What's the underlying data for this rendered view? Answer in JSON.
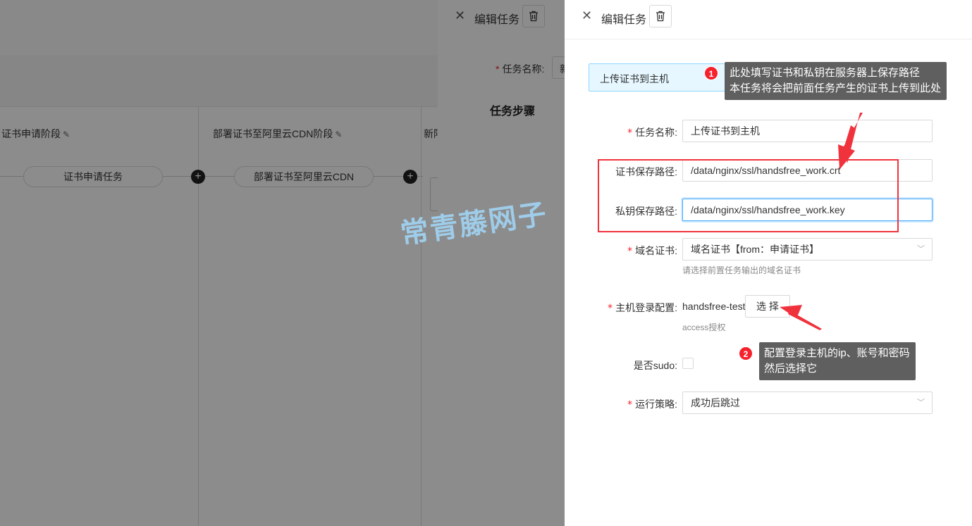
{
  "background": {
    "stages": [
      {
        "title": "证书申请阶段",
        "task": "证书申请任务"
      },
      {
        "title": "部署证书至阿里云CDN阶段",
        "task": "部署证书至阿里云CDN"
      },
      {
        "title": "新阿"
      }
    ],
    "edit_icon": "pencil-icon",
    "add_icon": "plus-icon"
  },
  "drawer_back": {
    "title": "编辑任务",
    "task_name_label": "任务名称:",
    "task_name_value_partial": "新",
    "steps_heading": "任务步骤"
  },
  "drawer": {
    "title": "编辑任务",
    "close_icon": "close-icon",
    "delete_icon": "trash-icon",
    "task_type": "上传证书到主机",
    "fields": {
      "task_name": {
        "label": "任务名称:",
        "value": "上传证书到主机"
      },
      "cert_path": {
        "label": "证书保存路径:",
        "value": "/data/nginx/ssl/handsfree_work.crt"
      },
      "key_path": {
        "label": "私钥保存路径:",
        "value": "/data/nginx/ssl/handsfree_work.key"
      },
      "domain_cert": {
        "label": "域名证书:",
        "value": "域名证书【from：申请证书】",
        "help": "请选择前置任务输出的域名证书"
      },
      "host_login": {
        "label": "主机登录配置:",
        "value": "handsfree-test",
        "button": "选 择",
        "help": "access授权"
      },
      "sudo": {
        "label": "是否sudo:",
        "checked": false
      },
      "strategy": {
        "label": "运行策略:",
        "value": "成功后跳过"
      }
    }
  },
  "annotations": {
    "note1": {
      "badge": "1",
      "line1": "此处填写证书和私钥在服务器上保存路径",
      "line2": "本任务将会把前面任务产生的证书上传到此处"
    },
    "note2": {
      "badge": "2",
      "line1": "配置登录主机的ip、账号和密码",
      "line2": "然后选择它"
    },
    "watermark": "常青藤网子"
  },
  "colors": {
    "required": "#f5222d",
    "focus": "#40a9ff",
    "annotation_red": "#f0323c",
    "tip_bg": "#5f5f5f"
  }
}
